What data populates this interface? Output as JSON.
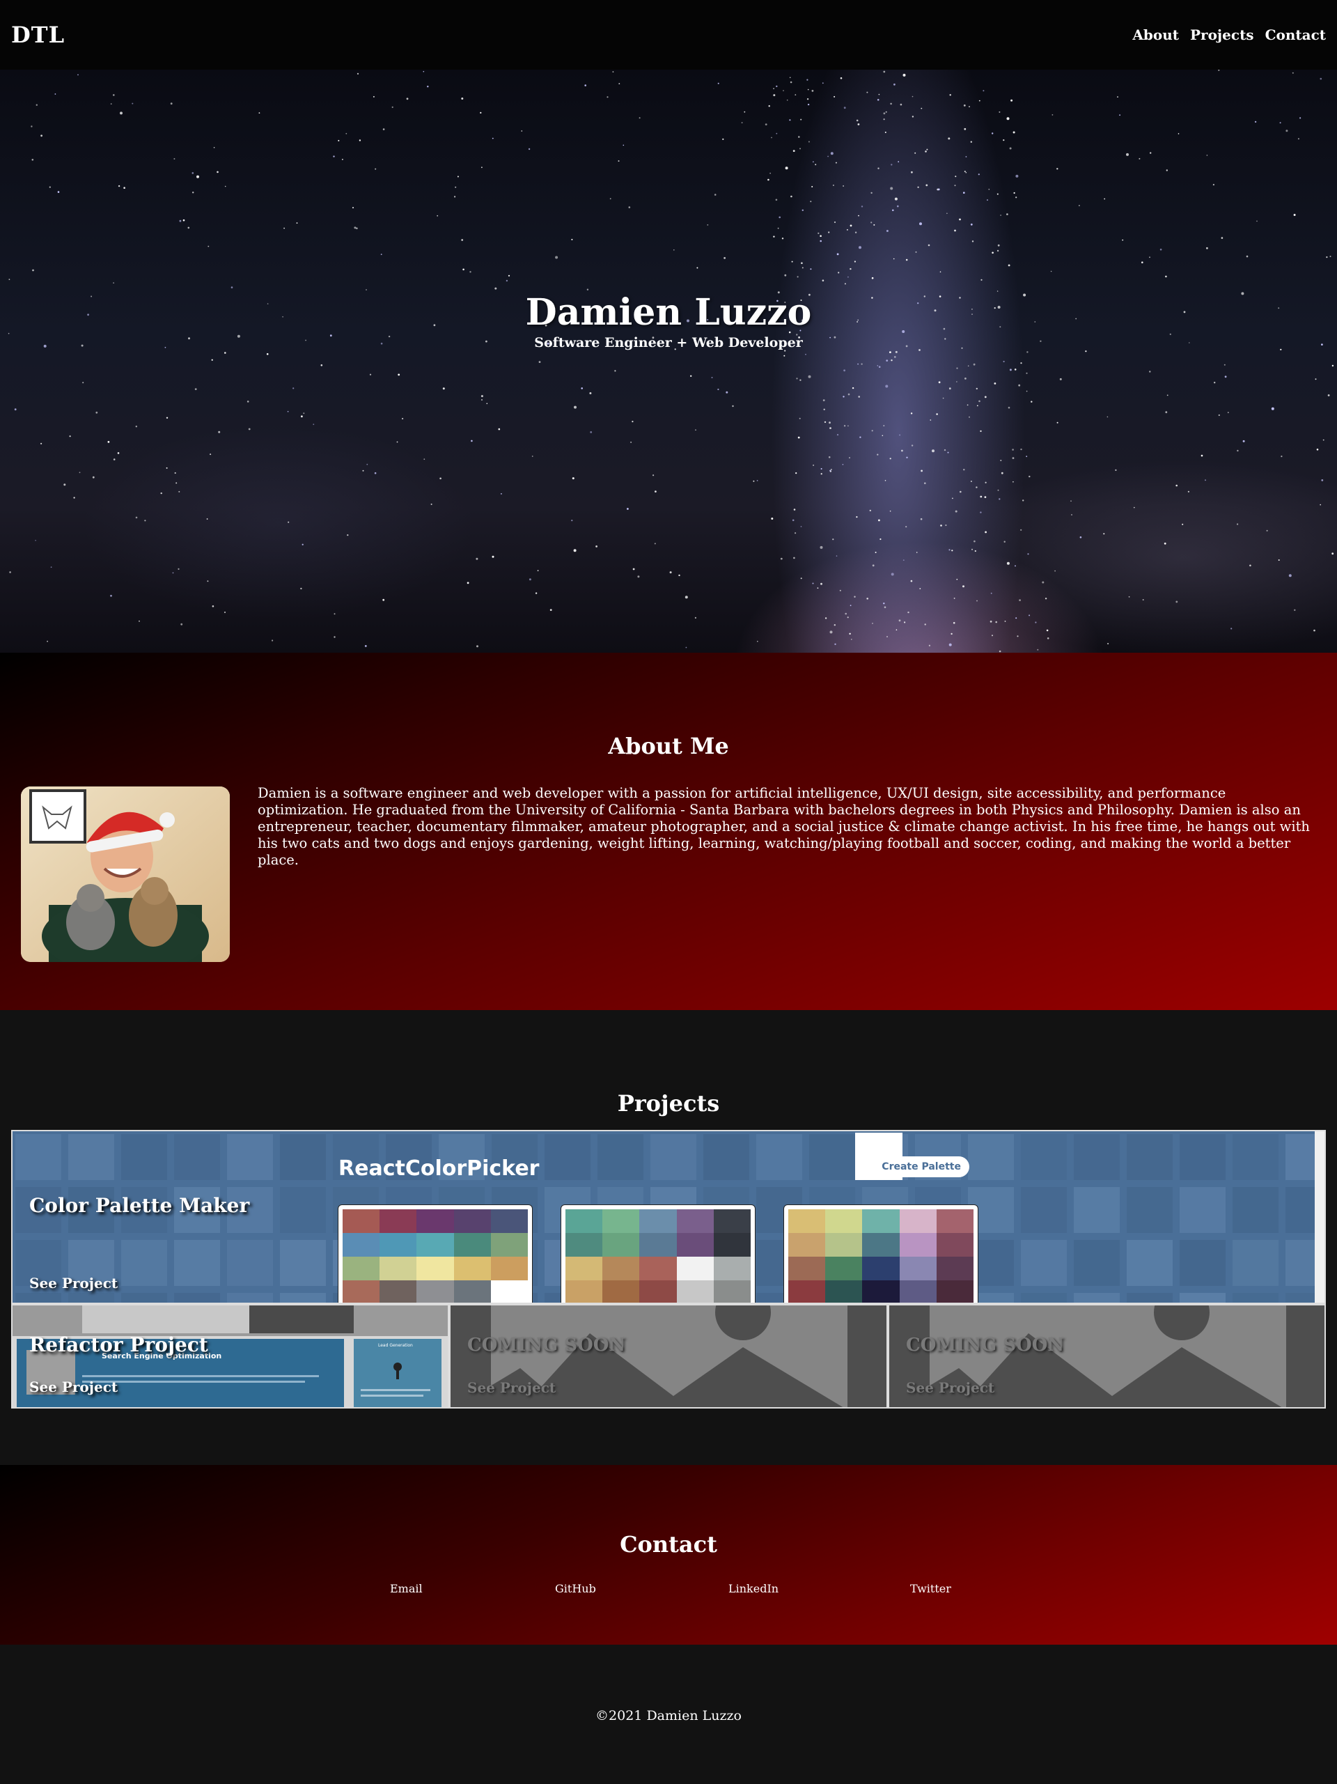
{
  "nav": {
    "brand": "DTL",
    "links": [
      "About",
      "Projects",
      "Contact"
    ]
  },
  "hero": {
    "title": "Damien Luzzo",
    "subtitle": "Software Engineer + Web Developer"
  },
  "about": {
    "title": "About Me",
    "bio": "Damien is a software engineer and web developer with a passion for artificial intelligence, UX/UI design, site accessibility, and performance optimization. He graduated from the University of California - Santa Barbara with bachelors degrees in both Physics and Philosophy. Damien is also an entrepreneur, teacher, documentary filmmaker, amateur photographer, and a social justice & climate change activist. In his free time, he hangs out with his two cats and two dogs and enjoys gardening, weight lifting, learning, watching/playing football and soccer, coding, and making the world a better place."
  },
  "projects": {
    "title": "Projects",
    "cards": [
      {
        "title": "Color Palette Maker",
        "link": "See Project",
        "preview": {
          "app_title": "ReactColorPicker",
          "button": "Create Palette",
          "palettes": [
            [
              "#a55a54",
              "#8a3b55",
              "#6a386d",
              "#58426e",
              "#4a5579",
              "#5a8db5",
              "#4f98b6",
              "#58a9b4",
              "#4a8a7c",
              "#7fa27a",
              "#9ab37f",
              "#d1d194",
              "#f0e6a0",
              "#dcbf70",
              "#cc9e5f",
              "#a86a5a",
              "#6f625e",
              "#8e8f93",
              "#6b747c",
              "#ffffff"
            ],
            [
              "#5aa596",
              "#77b58e",
              "#6b8eab",
              "#7a5f8c",
              "#3a3f48",
              "#4f8b7f",
              "#69a47f",
              "#5a7a95",
              "#6a4d7a",
              "#30343c",
              "#d4b975",
              "#b5885a",
              "#a9625a",
              "#f2f2f2",
              "#a9aeae",
              "#c9a166",
              "#a06a43",
              "#8e4a46",
              "#c7c7c7",
              "#8a8d8c"
            ],
            [
              "#d9be74",
              "#d0d78e",
              "#6fb2a9",
              "#d7b4c9",
              "#a4636d",
              "#c9a26d",
              "#b5c38a",
              "#4c7786",
              "#b994c2",
              "#80495c",
              "#9c6a55",
              "#4a8260",
              "#2c3f6e",
              "#8a87b2",
              "#5c3b53",
              "#8b3b3f",
              "#2c5452",
              "#1c1a3a",
              "#5e5b85",
              "#4a2a3a"
            ]
          ]
        }
      },
      {
        "title": "Refactor Project",
        "link": "See Project",
        "preview": {
          "heading": "Search Engine Optimization",
          "side_heading": "Lead Generation"
        }
      },
      {
        "title": "COMING SOON",
        "link": "See Project"
      },
      {
        "title": "COMING SOON",
        "link": "See Project"
      }
    ]
  },
  "contact": {
    "title": "Contact",
    "links": [
      "Email",
      "GitHub",
      "LinkedIn",
      "Twitter"
    ]
  },
  "footer": {
    "copyright": "©2021 Damien Luzzo"
  },
  "colors": {
    "nav_bg": "#050505",
    "section_bg": "#121212",
    "accent_red": "#9d0000",
    "card_blue": "#4a6f98"
  }
}
